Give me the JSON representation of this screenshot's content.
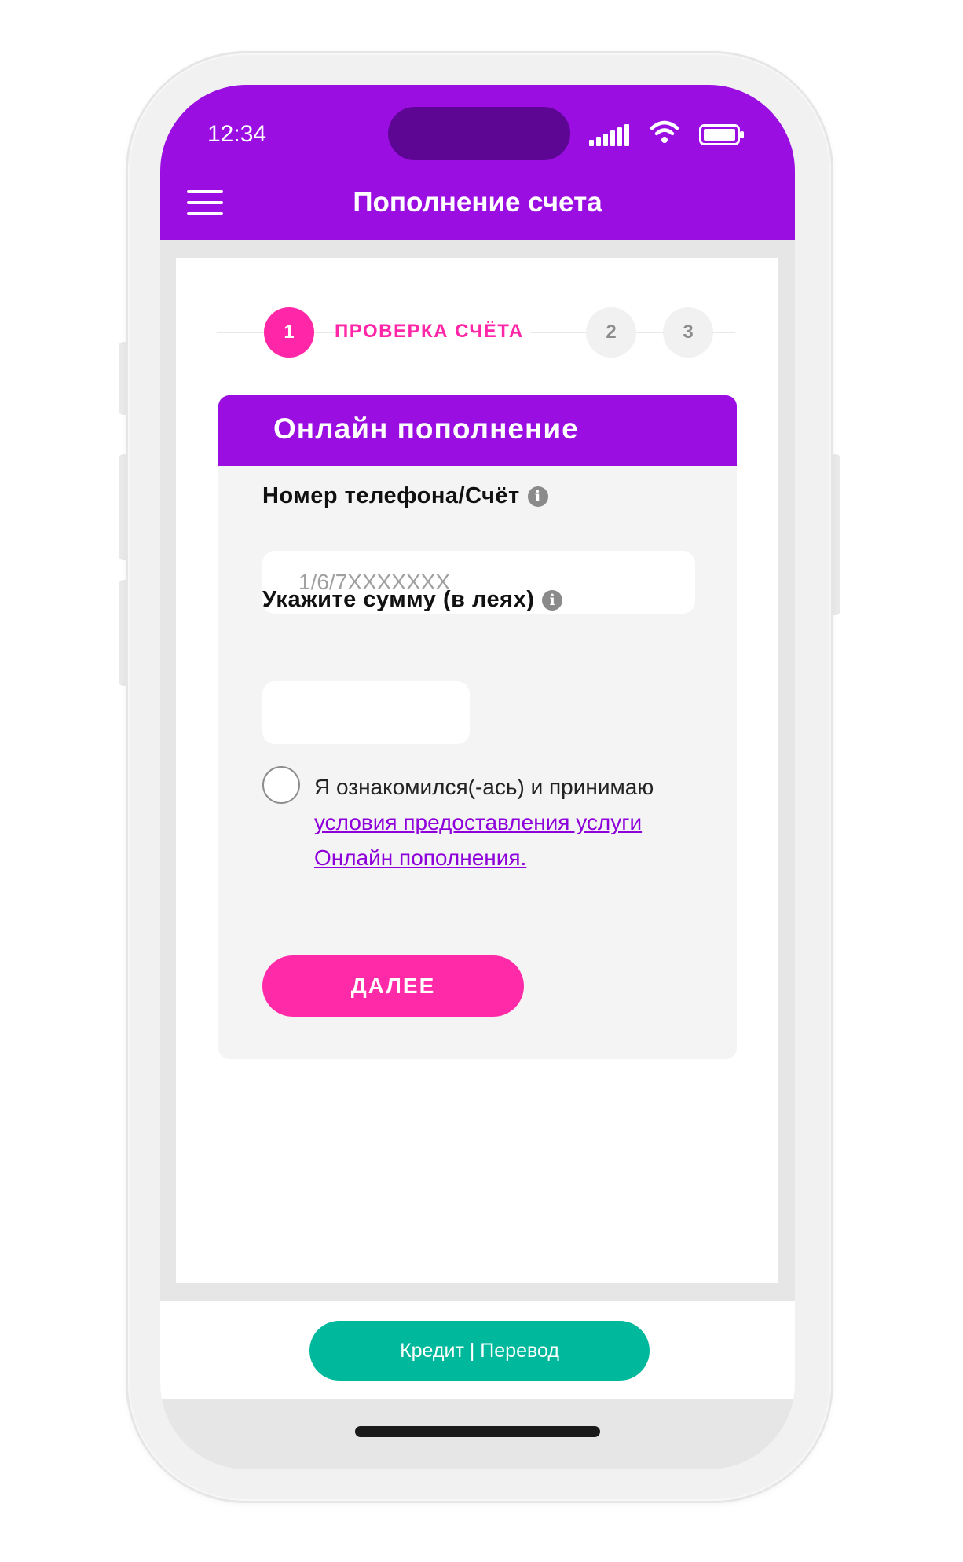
{
  "status_bar": {
    "time": "12:34",
    "icons": [
      "cellular-signal-icon",
      "wifi-icon",
      "battery-icon"
    ]
  },
  "header": {
    "menu_icon": "hamburger-menu-icon",
    "title": "Пополнение счета"
  },
  "stepper": {
    "steps": [
      {
        "number": "1",
        "label": "ПРОВЕРКА СЧЁТА",
        "active": true
      },
      {
        "number": "2",
        "active": false
      },
      {
        "number": "3",
        "active": false
      }
    ]
  },
  "form": {
    "title": "Онлайн пополнение",
    "phone": {
      "label": "Номер телефона/Счёт",
      "placeholder": "1/6/7XXXXXXX",
      "value": ""
    },
    "amount": {
      "label": "Укажите сумму (в леях)",
      "value": ""
    },
    "consent": {
      "checked": false,
      "text": "Я ознакомился(-ась) и принимаю ",
      "link_text": "условия предоставления услуги Онлайн пополнения."
    },
    "next_label": "ДАЛЕЕ"
  },
  "footer": {
    "button_label": "Кредит | Перевод"
  },
  "colors": {
    "brand_purple": "#9a0ee2",
    "accent_pink": "#ff26a8",
    "teal": "#00b89b",
    "link": "#8e00d9"
  }
}
